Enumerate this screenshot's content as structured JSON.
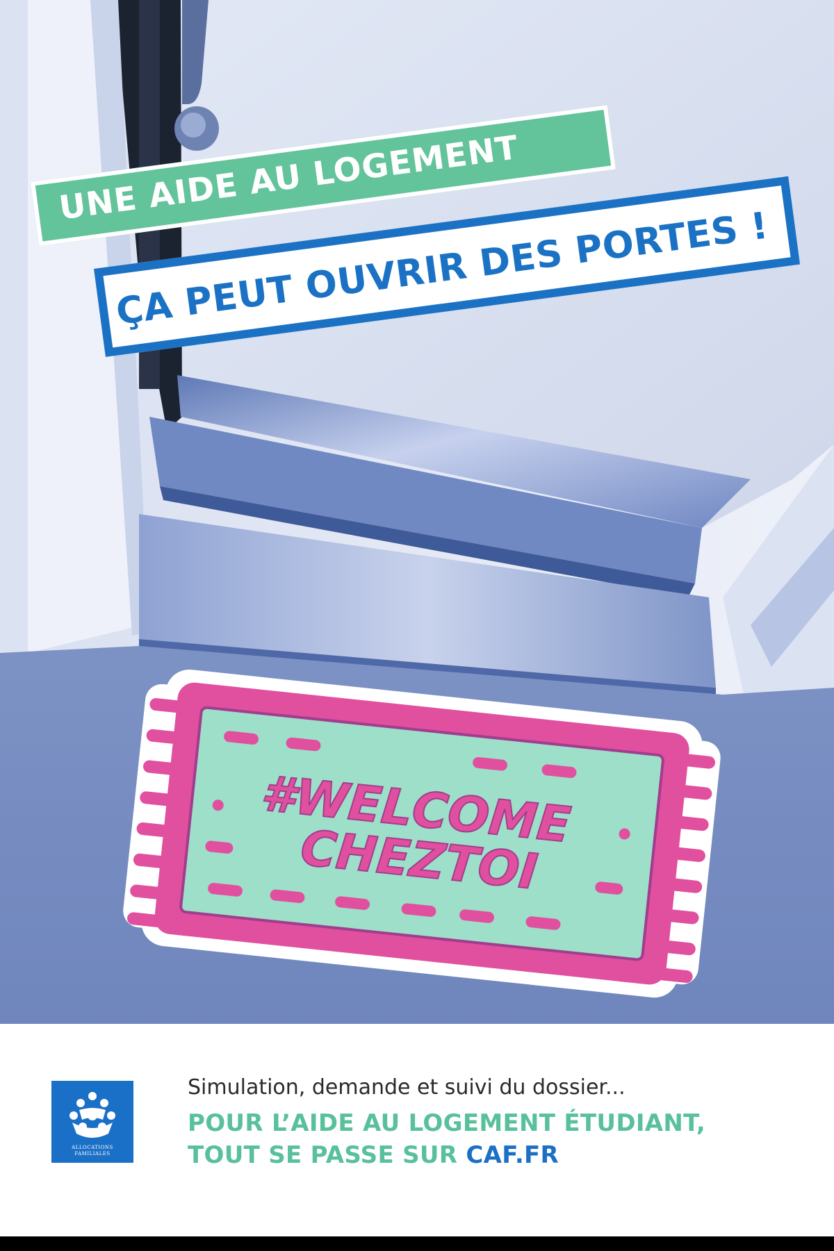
{
  "headline": {
    "line1": "UNE AIDE AU LOGEMENT",
    "line2": "ÇA PEUT OUVRIR DES PORTES !"
  },
  "mat": {
    "line1": "#WELCOME",
    "line2": "CHEZTOI"
  },
  "logo": {
    "name": "caf-logo",
    "text_line1": "ALLOCATIONS",
    "text_line2": "FAMILIALES"
  },
  "footer": {
    "line1": "Simulation, demande et suivi du dossier...",
    "line2": "POUR L’AIDE AU LOGEMENT ÉTUDIANT,",
    "line3_prefix": "TOUT SE PASSE SUR ",
    "line3_link": "CAF.FR"
  },
  "colors": {
    "green": "#63c39a",
    "blue": "#1b72c4",
    "pink": "#e0509f",
    "mint": "#9ddfc8",
    "photo_tint": "#7f97c8"
  }
}
